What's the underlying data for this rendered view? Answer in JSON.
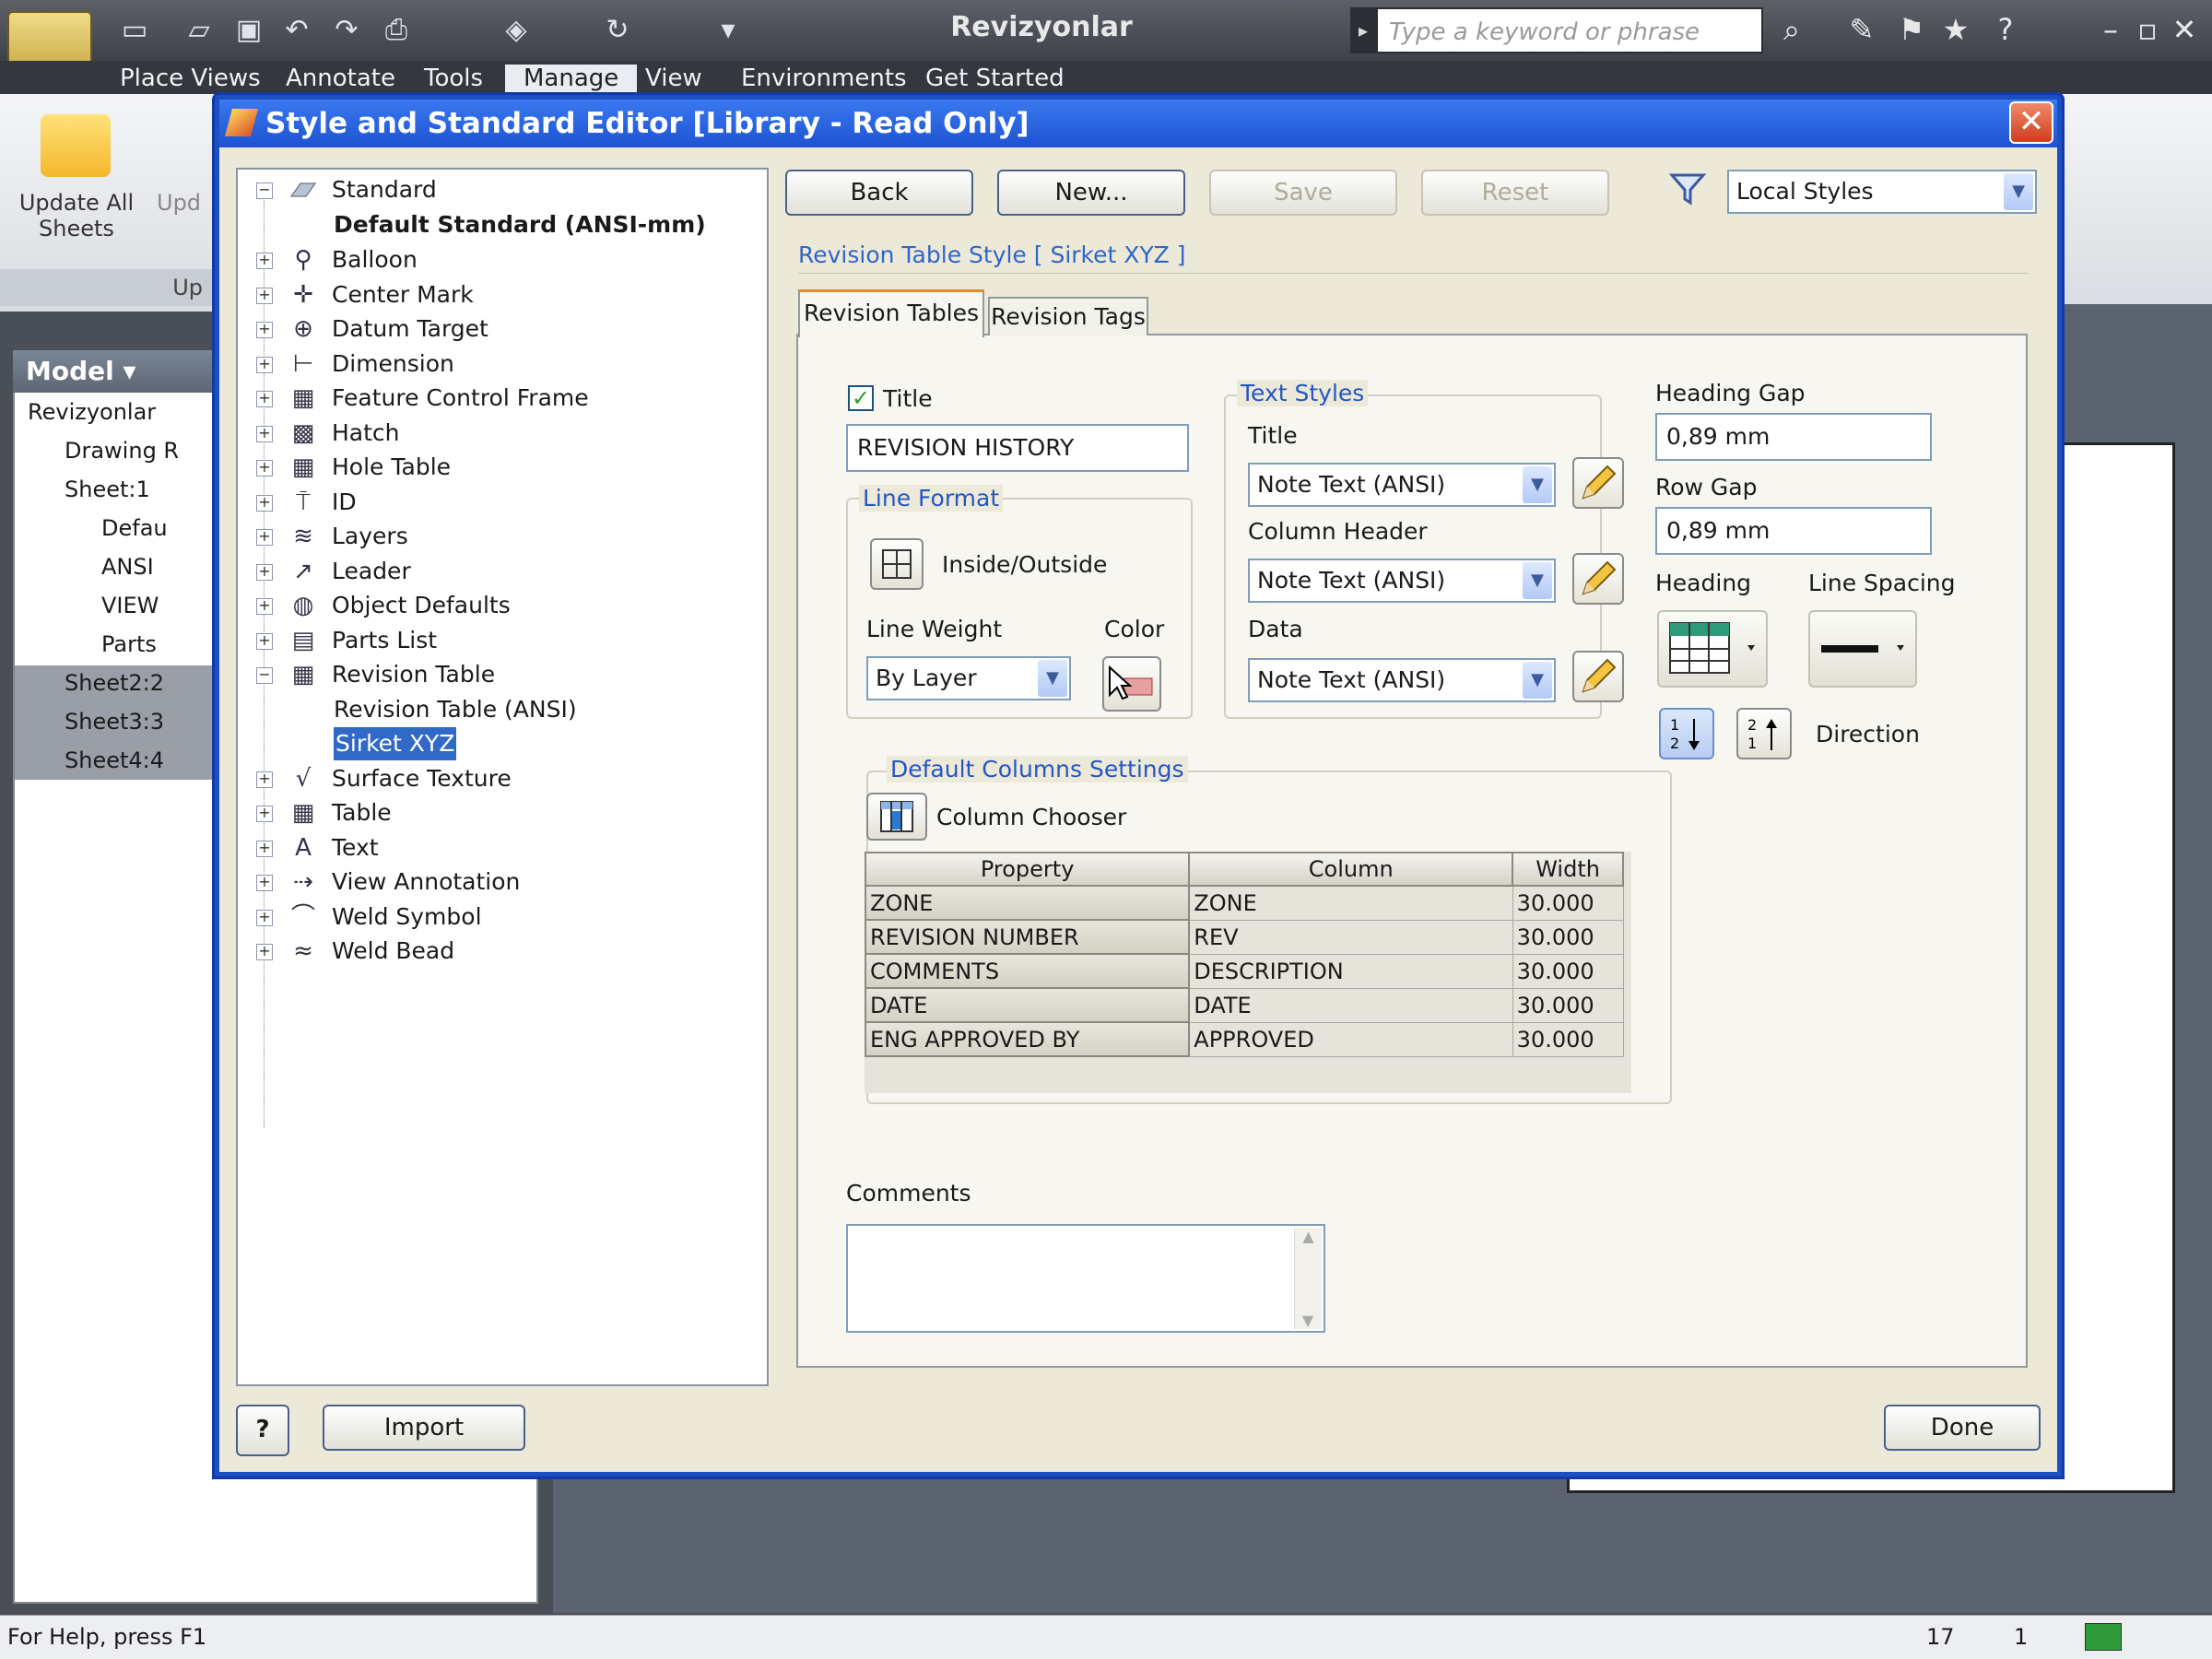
{
  "app": {
    "title": "Revizyonlar",
    "search_placeholder": "Type a keyword or phrase",
    "ribbon_tabs": [
      "Place Views",
      "Annotate",
      "Tools",
      "Manage",
      "View",
      "Environments",
      "Get Started"
    ],
    "ribbon_buttons": {
      "update_all": "Update All Sheets",
      "update_partial": "Upd",
      "panel_label": "Up"
    },
    "status_left": "For Help, press F1",
    "status_num1": "17",
    "status_num2": "1"
  },
  "browser": {
    "header": "Model",
    "items": [
      "Revizyonlar",
      "Drawing R",
      "Sheet:1",
      "Defau",
      "ANSI",
      "VIEW",
      "Parts",
      "Sheet2:2",
      "Sheet3:3",
      "Sheet4:4"
    ]
  },
  "dialog": {
    "title": "Style and Standard Editor [Library - Read Only]",
    "tree": {
      "root": "Standard",
      "default": "Default Standard (ANSI-mm)",
      "items": [
        "Balloon",
        "Center Mark",
        "Datum Target",
        "Dimension",
        "Feature Control Frame",
        "Hatch",
        "Hole Table",
        "ID",
        "Layers",
        "Leader",
        "Object Defaults",
        "Parts List",
        "Revision Table"
      ],
      "sub": [
        "Revision Table (ANSI)",
        "Sirket XYZ"
      ],
      "items2": [
        "Surface Texture",
        "Table",
        "Text",
        "View Annotation",
        "Weld Symbol",
        "Weld Bead"
      ]
    },
    "buttons": {
      "back": "Back",
      "new": "New...",
      "save": "Save",
      "reset": "Reset",
      "import": "Import",
      "done": "Done",
      "help": "?"
    },
    "filter": "Local Styles",
    "style_header": "Revision Table Style [ Sirket XYZ ]",
    "tabs": [
      "Revision Tables",
      "Revision Tags"
    ],
    "title_checked": true,
    "title_label": "Title",
    "title_value": "REVISION HISTORY",
    "line_format": {
      "group": "Line Format",
      "inside_outside": "Inside/Outside",
      "line_weight_label": "Line Weight",
      "line_weight": "By Layer",
      "color_label": "Color"
    },
    "text_styles": {
      "group": "Text Styles",
      "title_label": "Title",
      "title": "Note Text (ANSI)",
      "column_header_label": "Column Header",
      "column_header": "Note Text (ANSI)",
      "data_label": "Data",
      "data": "Note Text (ANSI)"
    },
    "heading_gap": {
      "label": "Heading Gap",
      "value": "0,89 mm"
    },
    "row_gap": {
      "label": "Row Gap",
      "value": "0,89 mm"
    },
    "heading_label": "Heading",
    "line_spacing_label": "Line Spacing",
    "direction_label": "Direction",
    "columns": {
      "group": "Default Columns Settings",
      "chooser": "Column Chooser",
      "headers": [
        "Property",
        "Column",
        "Width"
      ],
      "rows": [
        [
          "ZONE",
          "ZONE",
          "30.000"
        ],
        [
          "REVISION NUMBER",
          "REV",
          "30.000"
        ],
        [
          "COMMENTS",
          "DESCRIPTION",
          "30.000"
        ],
        [
          "DATE",
          "DATE",
          "30.000"
        ],
        [
          "ENG APPROVED BY",
          "APPROVED",
          "30.000"
        ]
      ]
    },
    "comments_label": "Comments",
    "comments_value": ""
  }
}
